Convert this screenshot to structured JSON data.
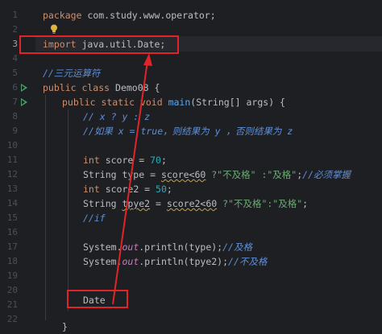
{
  "editor": {
    "line_numbers": [
      "1",
      "2",
      "3",
      "4",
      "5",
      "6",
      "7",
      "8",
      "9",
      "10",
      "11",
      "12",
      "13",
      "14",
      "15",
      "16",
      "17",
      "18",
      "19",
      "20",
      "21",
      "22"
    ],
    "current_line": "3",
    "lines": {
      "l1": {
        "kw": "package",
        "rest": " com.study.www.operator;"
      },
      "l3": {
        "kw": "import",
        "rest": " java.util.Date;"
      },
      "l5": {
        "comment": "//三元运算符"
      },
      "l6": {
        "kw": "public class",
        "rest": " Demo08 {"
      },
      "l7": {
        "kw": "public static void",
        "fn": "main",
        "rest": "(String[] args) {"
      },
      "l8": {
        "doc": "// x ? y : z"
      },
      "l9": {
        "doc": "//如果 x = true，则结果为 y ，否则结果为 z"
      },
      "l11": {
        "kw": "int",
        "rest": " score = ",
        "num": "70",
        "end": ";"
      },
      "l12": {
        "pre": "String type = ",
        "warn": "score<60",
        "str": " ?\"不及格\" :\"及格\"",
        "end": ";",
        "comment": "//必须掌握"
      },
      "l13": {
        "kw": "int",
        "rest": " score2 = ",
        "num": "50",
        "end": ";"
      },
      "l14": {
        "pre": "String ",
        "warn": "tpye2",
        "mid": " = ",
        "warn2": "score2<60",
        "str": " ?\"不及格\":\"及格\"",
        "end": ";"
      },
      "l15": {
        "doc": "//if"
      },
      "l17": {
        "obj": "System.",
        "static": "out",
        "call": ".println(type);",
        "comment": "//及格"
      },
      "l18": {
        "obj": "System.",
        "static": "out",
        "call": ".println(tpye2);",
        "comment": "//不及格"
      },
      "l21": {
        "text": "Date"
      },
      "l22": {
        "text": "}"
      }
    }
  },
  "colors": {
    "background": "#1e1f22",
    "annotation_red": "#e1242a",
    "keyword": "#cf8e6d",
    "doc_comment": "#5f8fd7",
    "number": "#2aacb8",
    "string": "#6aab73",
    "run_icon": "#4aa36b"
  },
  "icons": [
    "run-gutter-icon",
    "intention-bulb-icon"
  ]
}
